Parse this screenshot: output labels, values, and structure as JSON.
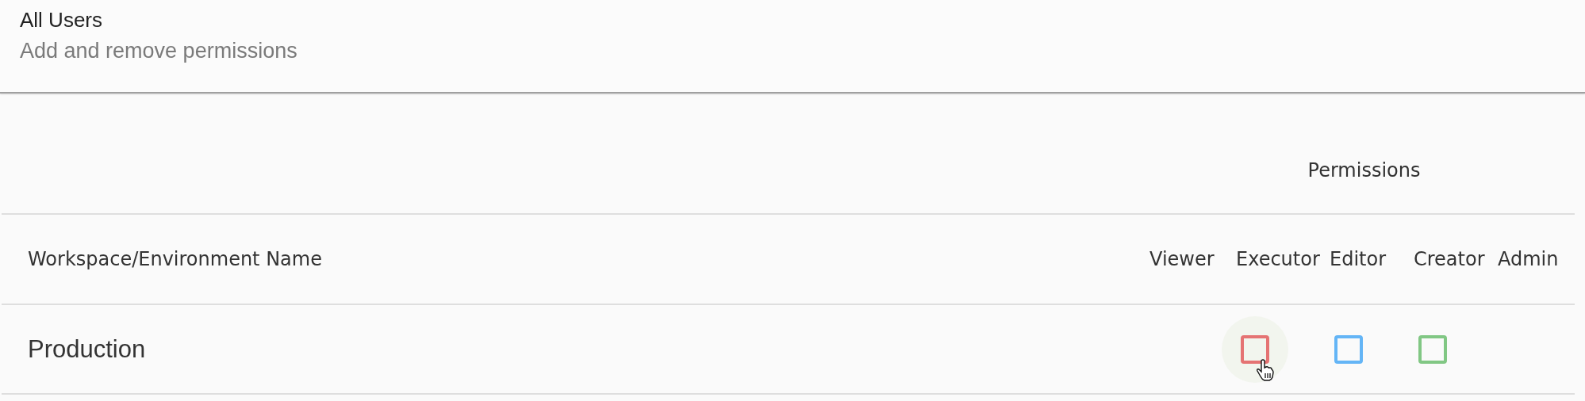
{
  "header": {
    "title": "All Users",
    "subtitle": "Add and remove permissions"
  },
  "table": {
    "group_heading": "Permissions",
    "columns": [
      "Workspace/Environment Name",
      "Viewer",
      "Executor",
      "Editor",
      "Creator",
      "Admin"
    ],
    "rows": [
      {
        "name": "Production",
        "cells": [
          {
            "kind": "empty"
          },
          {
            "kind": "checkbox",
            "checked": false,
            "color": "#e57373",
            "hovered": true
          },
          {
            "kind": "checkbox",
            "checked": false,
            "color": "#64b5f6",
            "hovered": false
          },
          {
            "kind": "checkbox",
            "checked": false,
            "color": "#81c784",
            "hovered": false
          },
          {
            "kind": "empty"
          }
        ]
      }
    ]
  }
}
